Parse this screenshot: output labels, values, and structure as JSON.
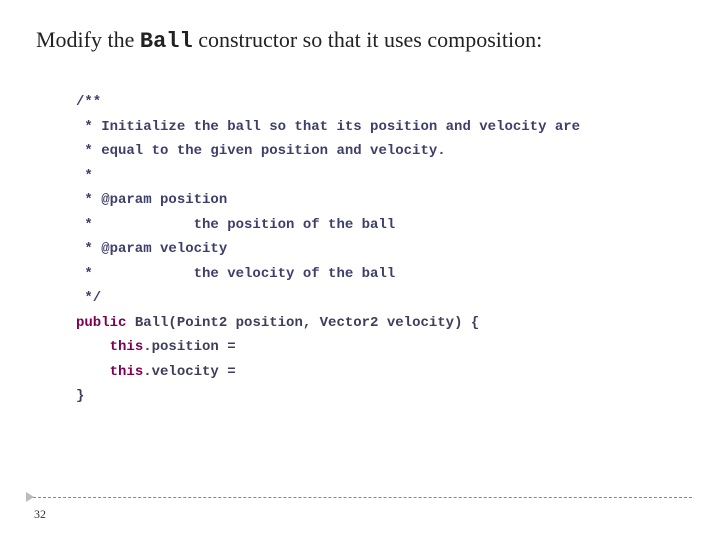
{
  "title": {
    "pre": "Modify the ",
    "mono": "Ball",
    "post": " constructor so that it uses composition:"
  },
  "code": {
    "l1": "/**",
    "l2": " * Initialize the ball so that its position and velocity are",
    "l3": " * equal to the given position and velocity.",
    "l4": " *",
    "l5": " * @param position",
    "l6": " *            the position of the ball",
    "l7": " * @param velocity",
    "l8": " *            the velocity of the ball",
    "l9": " */",
    "l10_kw": "public",
    "l10_rest": " Ball(Point2 position, Vector2 velocity) {",
    "l11_pre": "    ",
    "l11_kw": "this",
    "l11_rest": ".position = ",
    "l12_pre": "    ",
    "l12_kw": "this",
    "l12_rest": ".velocity = ",
    "l13": "}"
  },
  "slide_number": "32"
}
